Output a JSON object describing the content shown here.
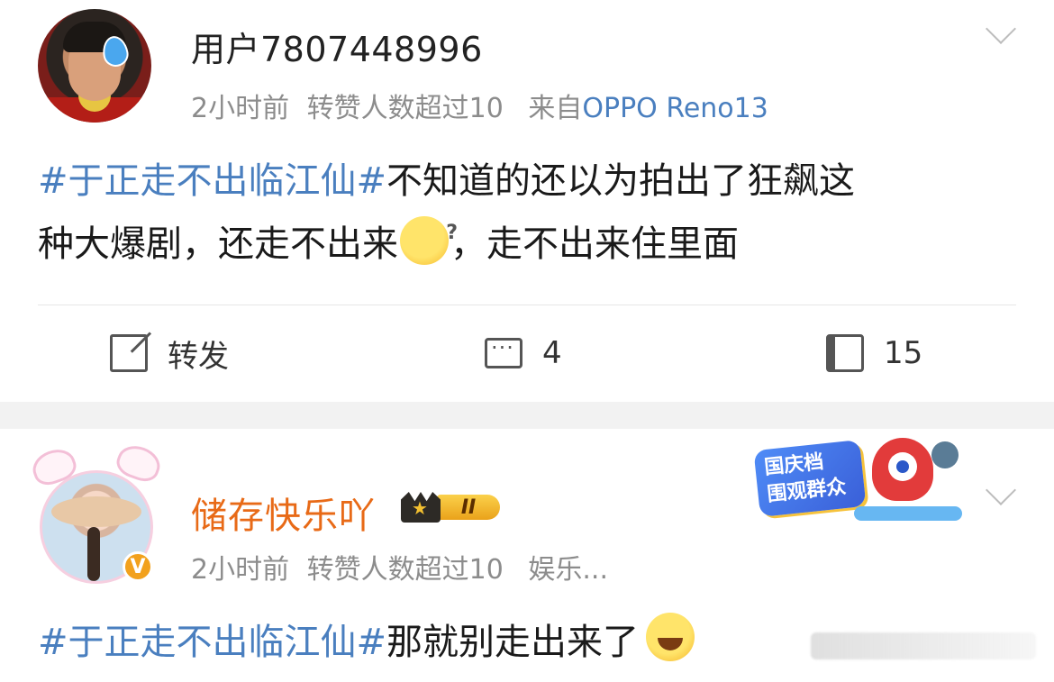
{
  "post1": {
    "username": "用户7807448996",
    "time": "2小时前",
    "reposts_info": "转赞人数超过10",
    "source_prefix": "来自",
    "source": "OPPO Reno13",
    "topic": "#于正走不出临江仙#",
    "text_line1": "不知道的还以为拍出了狂飙这",
    "text_line2_a": "种大爆剧，还走不出来",
    "text_line2_b": "，走不出来住里面",
    "emoji": "dizzy-face-icon",
    "actions": {
      "repost_label": "转发",
      "comment_count": "4",
      "like_count": "15"
    }
  },
  "post2": {
    "username": "储存快乐吖",
    "level": "II",
    "verified_badge": "V",
    "time": "2小时前",
    "reposts_info": "转赞人数超过10",
    "category": "娱乐...",
    "topic": "#于正走不出临江仙#",
    "text": "那就别走出来了",
    "emoji": "laughing-tears-icon",
    "promo": {
      "label_line1": "国庆档",
      "label_line2": "围观群众"
    }
  },
  "colors": {
    "topic_blue": "#4a7fbf",
    "username_orange": "#e86a17",
    "meta_gray": "#8c8c8c",
    "separator": "#f2f2f2"
  }
}
